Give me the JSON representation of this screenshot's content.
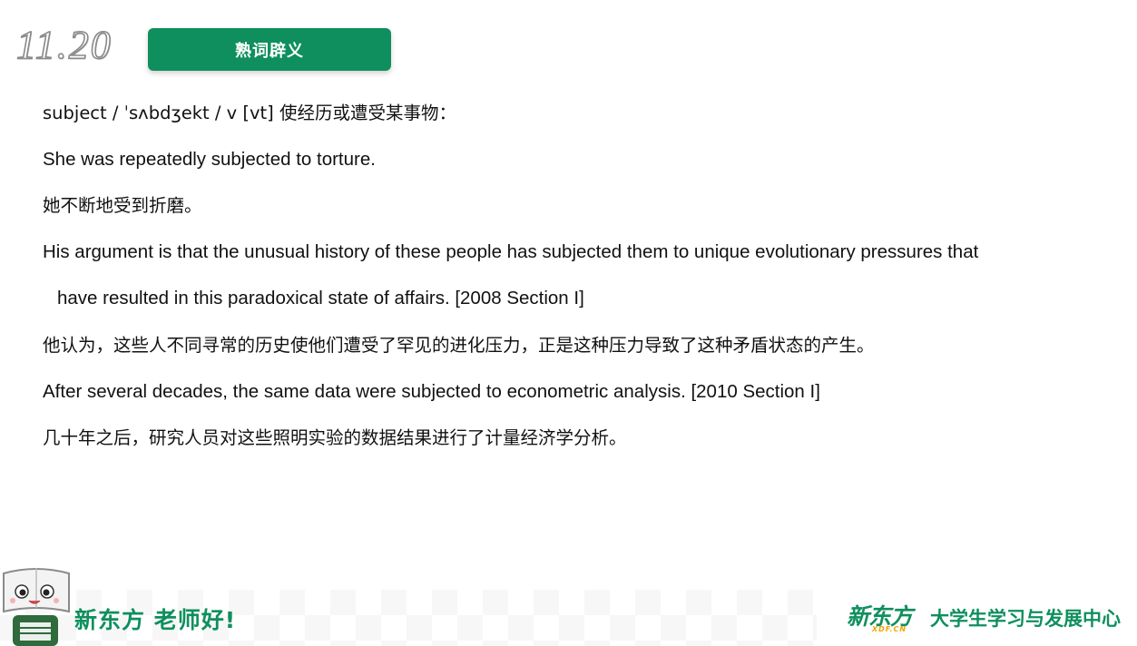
{
  "header": {
    "date": "11.20",
    "section_title": "熟词辟义"
  },
  "content": {
    "lines": [
      "subject  / ˈsʌbdʒekt / v [vt] 使经历或遭受某事物：",
      "She was repeatedly subjected to torture.",
      "她不断地受到折磨。",
      "His argument is that the unusual history of these people has subjected them to unique evolutionary pressures that",
      "have resulted in this paradoxical state of affairs. [2008 Section I]",
      "他认为，这些人不同寻常的历史使他们遭受了罕见的进化压力，正是这种压力导致了这种矛盾状态的产生。",
      "After several decades, the same data were subjected to econometric analysis. [2010 Section I]",
      "几十年之后，研究人员对这些照明实验的数据结果进行了计量经济学分析。"
    ]
  },
  "footer": {
    "slogan": "新东方 老师好!",
    "brand_cn": "新东方",
    "brand_en": "XDF.CN",
    "center_name": "大学生学习与发展中心"
  },
  "colors": {
    "brand_green": "#0f8f5e",
    "brand_orange": "#f0a500"
  },
  "icons": {
    "mascot": "book-mascot-icon"
  }
}
